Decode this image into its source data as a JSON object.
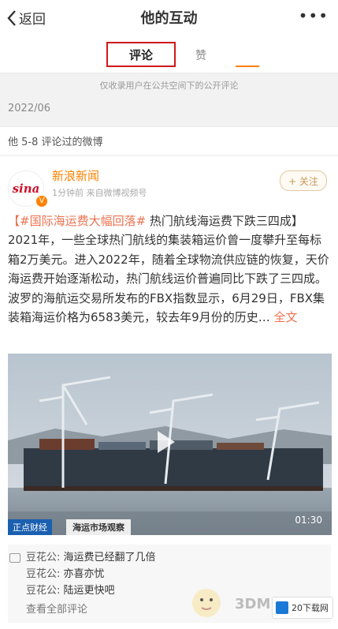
{
  "header": {
    "back_label": "返回",
    "title": "他的互动",
    "more": "•••"
  },
  "tabs": {
    "comment": "评论",
    "like": "赞"
  },
  "notice": "仅收录用户在公共空间下的公开评论",
  "date": "2022/06",
  "subheader": "他 5-8 评论过的微博",
  "post": {
    "logo_text": "sina",
    "username": "新浪新闻",
    "meta": "1分钟前  来自微博视频号",
    "follow_label": "+ 关注",
    "topic": "【#国际海运费大幅回落#",
    "text": " 热门航线海运费下跌三四成】2021年，一些全球热门航线的集装箱运价曾一度攀升至每标箱2万美元。进入2022年，随着全球物流供应链的恢复，天价海运费开始逐渐松动，热门航线运价普遍同比下跌了三四成。波罗的海航运交易所发布的FBX指数显示，6月29日，FBX集装箱海运价格为6583美元，较去年9月份的历史… ",
    "full_text_link": "全文",
    "video": {
      "duration": "01:30",
      "tv_logo": "正点财经",
      "caption": "海运市场观察"
    }
  },
  "comments": [
    {
      "name": "豆花公:",
      "text": " 海运费已经翻了几倍"
    },
    {
      "name": "豆花公:",
      "text": " 亦喜亦忧"
    },
    {
      "name": "豆花公:",
      "text": " 陆运更快吧"
    }
  ],
  "view_all": "查看全部评论",
  "watermarks": {
    "site1": "3DM",
    "site2": "20下载网"
  },
  "colors": {
    "accent": "#ff8200",
    "highlight_border": "#d01818",
    "link": "#eb7350"
  }
}
